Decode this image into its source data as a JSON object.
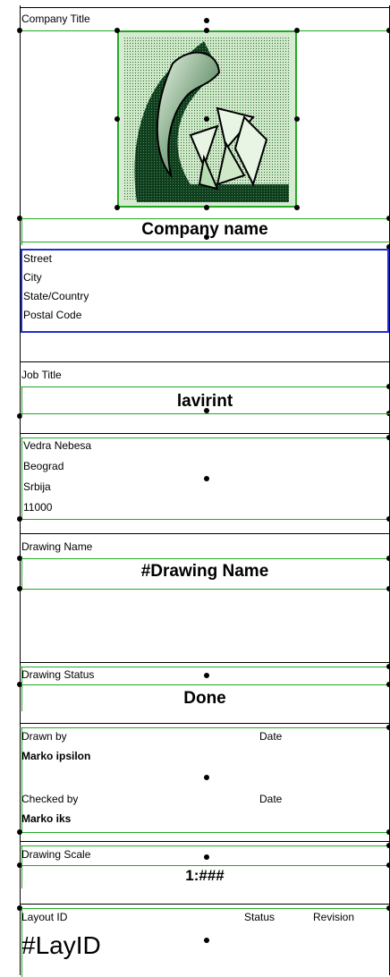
{
  "company_block": {
    "title_label": "Company Title",
    "company_name": "Company name",
    "address_lines": [
      "Street",
      "City",
      "State/Country",
      "Postal Code"
    ]
  },
  "job_block": {
    "label": "Job Title",
    "value": "lavirint",
    "address_lines": [
      "Vedra Nebesa",
      "Beograd",
      "Srbija",
      "11000"
    ]
  },
  "drawing_name_block": {
    "label": "Drawing Name",
    "value": "#Drawing Name"
  },
  "drawing_status_block": {
    "label": "Drawing Status",
    "value": "Done"
  },
  "drawn_block": {
    "drawn_by_label": "Drawn by",
    "drawn_by_value": "Marko ipsilon",
    "drawn_date_label": "Date",
    "checked_by_label": "Checked by",
    "checked_by_value": "Marko iks",
    "checked_date_label": "Date"
  },
  "scale_block": {
    "label": "Drawing Scale",
    "value": "1:###"
  },
  "layout_block": {
    "layout_id_label": "Layout ID",
    "status_label": "Status",
    "revision_label": "Revision",
    "layout_id_value": "#LayID"
  },
  "colors": {
    "selection_green": "#22aa22",
    "frame_blue": "#1f2fcc",
    "logo_dark_green": "#0f3d1e",
    "logo_light_green": "#cfe8c8"
  }
}
